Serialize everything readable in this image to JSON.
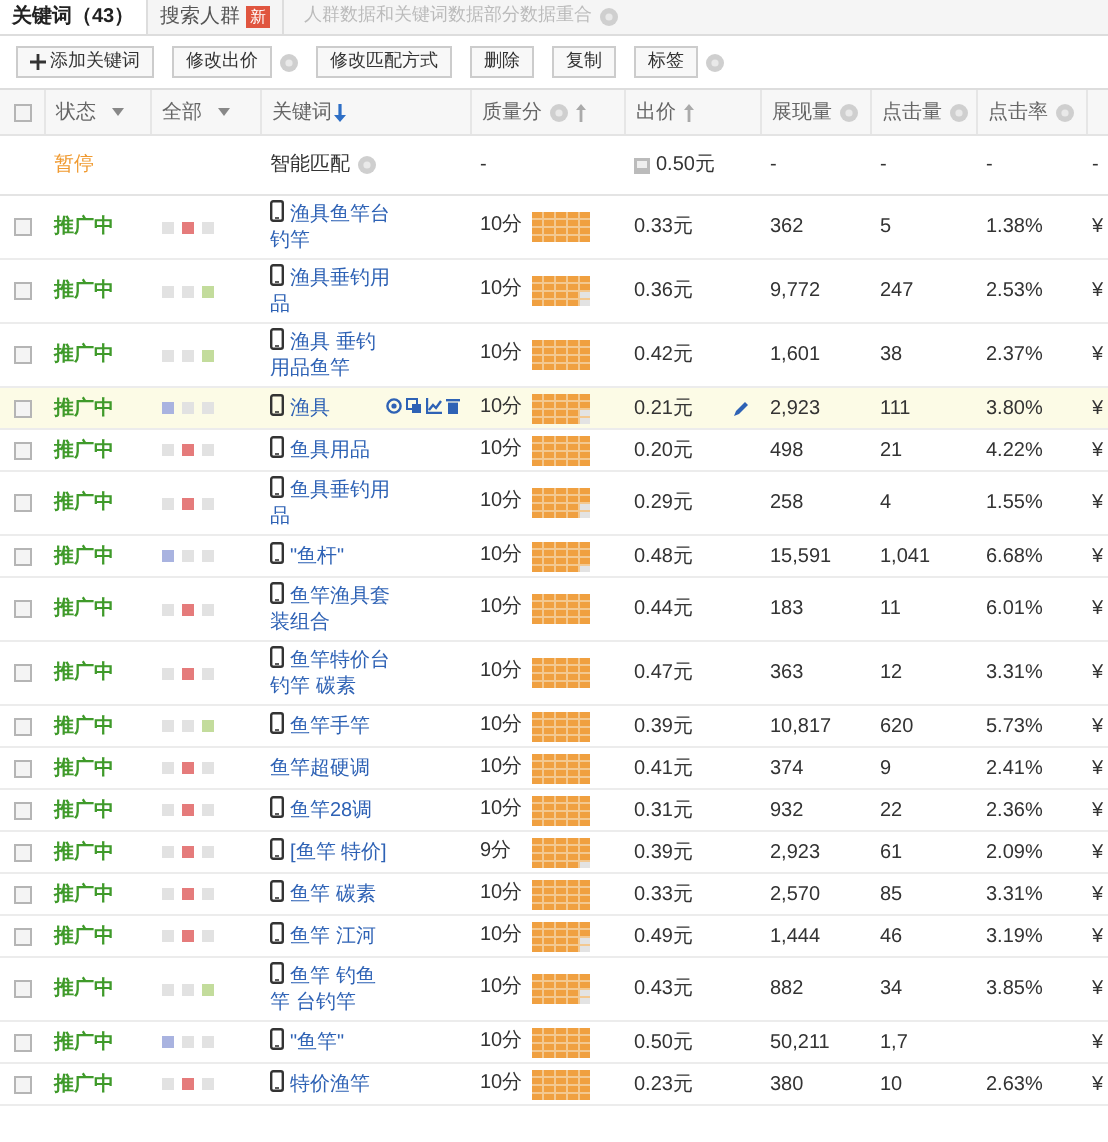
{
  "tabs": [
    {
      "label": "关键词（43）",
      "selected": true
    },
    {
      "label": "搜索人群",
      "badge": "新",
      "selected": false
    }
  ],
  "tab_note": "人群数据和关键词数据部分数据重合",
  "toolbar": [
    {
      "label": "添加关键词",
      "kind": "add",
      "help": false
    },
    {
      "label": "修改出价",
      "kind": "plain",
      "help": true
    },
    {
      "label": "修改匹配方式",
      "kind": "plain",
      "help": false
    },
    {
      "label": "删除",
      "kind": "plain",
      "help": false
    },
    {
      "label": "复制",
      "kind": "plain",
      "help": false
    },
    {
      "label": "标签",
      "kind": "plain",
      "help": true
    }
  ],
  "table": {
    "select_all": {
      "checked": false
    },
    "columns": [
      {
        "label": "状态",
        "kind": "dropdown"
      },
      {
        "label": "全部",
        "kind": "dropdown"
      },
      {
        "label": "关键词",
        "kind": "sorted"
      },
      {
        "label": "质量分",
        "kind": "help"
      },
      {
        "label": "出价",
        "kind": "sort"
      },
      {
        "label": "展现量",
        "kind": "help"
      },
      {
        "label": "点击量",
        "kind": "help"
      },
      {
        "label": "点击率",
        "kind": "help"
      }
    ],
    "smart_row": {
      "status": "暂停",
      "keyword": "智能匹配",
      "quality": "-",
      "bid": "0.50元",
      "impressions": "-",
      "clicks": "-",
      "ctr": "-",
      "column_9": "-"
    },
    "rows": [
      {
        "checked": false,
        "status": "推广中",
        "squares": [
          {
            "color": "#e2e2e2"
          },
          {
            "color": "#e57b7b"
          },
          {
            "color": "#e2e2e2"
          }
        ],
        "mobile": true,
        "keyword": "渔具鱼竿台钓竿",
        "quality": "10分",
        "level": 1,
        "bid": "0.33元",
        "impressions": "362",
        "clicks": "5",
        "ctr": "1.38%",
        "column_9": "¥",
        "highlighted": false
      },
      {
        "checked": false,
        "status": "推广中",
        "squares": [
          {
            "color": "#e2e2e2"
          },
          {
            "color": "#e2e2e2"
          },
          {
            "color": "#c3dc9c"
          }
        ],
        "mobile": true,
        "keyword": "渔具垂钓用品",
        "quality": "10分",
        "level": 0.9,
        "bid": "0.36元",
        "impressions": "9,772",
        "clicks": "247",
        "ctr": "2.53%",
        "column_9": "¥",
        "highlighted": false
      },
      {
        "checked": false,
        "status": "推广中",
        "squares": [
          {
            "color": "#e2e2e2"
          },
          {
            "color": "#e2e2e2"
          },
          {
            "color": "#c3dc9c"
          }
        ],
        "mobile": true,
        "keyword": "渔具 垂钓用品鱼竿",
        "quality": "10分",
        "level": 1,
        "bid": "0.42元",
        "impressions": "1,601",
        "clicks": "38",
        "ctr": "2.37%",
        "column_9": "¥",
        "highlighted": false
      },
      {
        "checked": false,
        "status": "推广中",
        "squares": [
          {
            "color": "#a9b3e0"
          },
          {
            "color": "#e2e2e2"
          },
          {
            "color": "#e2e2e2"
          }
        ],
        "mobile": true,
        "keyword": "渔具",
        "quality": "10分",
        "level": 0.9,
        "bid": "0.21元",
        "impressions": "2,923",
        "clicks": "111",
        "ctr": "3.80%",
        "column_9": "¥",
        "highlighted": true
      },
      {
        "checked": false,
        "status": "推广中",
        "squares": [
          {
            "color": "#e2e2e2"
          },
          {
            "color": "#e57b7b"
          },
          {
            "color": "#e2e2e2"
          }
        ],
        "mobile": true,
        "keyword": "鱼具用品",
        "quality": "10分",
        "level": 1,
        "bid": "0.20元",
        "impressions": "498",
        "clicks": "21",
        "ctr": "4.22%",
        "column_9": "¥",
        "highlighted": false
      },
      {
        "checked": false,
        "status": "推广中",
        "squares": [
          {
            "color": "#e2e2e2"
          },
          {
            "color": "#e57b7b"
          },
          {
            "color": "#e2e2e2"
          }
        ],
        "mobile": true,
        "keyword": "鱼具垂钓用品",
        "quality": "10分",
        "level": 0.9,
        "bid": "0.29元",
        "impressions": "258",
        "clicks": "4",
        "ctr": "1.55%",
        "column_9": "¥",
        "highlighted": false
      },
      {
        "checked": false,
        "status": "推广中",
        "squares": [
          {
            "color": "#a9b3e0"
          },
          {
            "color": "#e2e2e2"
          },
          {
            "color": "#e2e2e2"
          }
        ],
        "mobile": true,
        "keyword": "\"鱼杆\"",
        "quality": "10分",
        "level": 0.95,
        "bid": "0.48元",
        "impressions": "15,591",
        "clicks": "1,041",
        "ctr": "6.68%",
        "column_9": "¥",
        "highlighted": false
      },
      {
        "checked": false,
        "status": "推广中",
        "squares": [
          {
            "color": "#e2e2e2"
          },
          {
            "color": "#e57b7b"
          },
          {
            "color": "#e2e2e2"
          }
        ],
        "mobile": true,
        "keyword": "鱼竿渔具套装组合",
        "quality": "10分",
        "level": 1,
        "bid": "0.44元",
        "impressions": "183",
        "clicks": "11",
        "ctr": "6.01%",
        "column_9": "¥",
        "highlighted": false
      },
      {
        "checked": false,
        "status": "推广中",
        "squares": [
          {
            "color": "#e2e2e2"
          },
          {
            "color": "#e57b7b"
          },
          {
            "color": "#e2e2e2"
          }
        ],
        "mobile": true,
        "keyword": "鱼竿特价台钓竿 碳素",
        "quality": "10分",
        "level": 1,
        "bid": "0.47元",
        "impressions": "363",
        "clicks": "12",
        "ctr": "3.31%",
        "column_9": "¥",
        "highlighted": false
      },
      {
        "checked": false,
        "status": "推广中",
        "squares": [
          {
            "color": "#e2e2e2"
          },
          {
            "color": "#e2e2e2"
          },
          {
            "color": "#c3dc9c"
          }
        ],
        "mobile": true,
        "keyword": "鱼竿手竿",
        "quality": "10分",
        "level": 1,
        "bid": "0.39元",
        "impressions": "10,817",
        "clicks": "620",
        "ctr": "5.73%",
        "column_9": "¥",
        "highlighted": false
      },
      {
        "checked": false,
        "status": "推广中",
        "squares": [
          {
            "color": "#e2e2e2"
          },
          {
            "color": "#e57b7b"
          },
          {
            "color": "#e2e2e2"
          }
        ],
        "mobile": false,
        "keyword": "鱼竿超硬调",
        "quality": "10分",
        "level": 1,
        "bid": "0.41元",
        "impressions": "374",
        "clicks": "9",
        "ctr": "2.41%",
        "column_9": "¥",
        "highlighted": false
      },
      {
        "checked": false,
        "status": "推广中",
        "squares": [
          {
            "color": "#e2e2e2"
          },
          {
            "color": "#e57b7b"
          },
          {
            "color": "#e2e2e2"
          }
        ],
        "mobile": true,
        "keyword": "鱼竿28调",
        "quality": "10分",
        "level": 1,
        "bid": "0.31元",
        "impressions": "932",
        "clicks": "22",
        "ctr": "2.36%",
        "column_9": "¥",
        "highlighted": false
      },
      {
        "checked": false,
        "status": "推广中",
        "squares": [
          {
            "color": "#e2e2e2"
          },
          {
            "color": "#e57b7b"
          },
          {
            "color": "#e2e2e2"
          }
        ],
        "mobile": true,
        "keyword": "[鱼竿 特价]",
        "quality": "9分",
        "level": 0.95,
        "bid": "0.39元",
        "impressions": "2,923",
        "clicks": "61",
        "ctr": "2.09%",
        "column_9": "¥",
        "highlighted": false
      },
      {
        "checked": false,
        "status": "推广中",
        "squares": [
          {
            "color": "#e2e2e2"
          },
          {
            "color": "#e57b7b"
          },
          {
            "color": "#e2e2e2"
          }
        ],
        "mobile": true,
        "keyword": "鱼竿 碳素",
        "quality": "10分",
        "level": 1,
        "bid": "0.33元",
        "impressions": "2,570",
        "clicks": "85",
        "ctr": "3.31%",
        "column_9": "¥",
        "highlighted": false
      },
      {
        "checked": false,
        "status": "推广中",
        "squares": [
          {
            "color": "#e2e2e2"
          },
          {
            "color": "#e57b7b"
          },
          {
            "color": "#e2e2e2"
          }
        ],
        "mobile": true,
        "keyword": "鱼竿 江河",
        "quality": "10分",
        "level": 0.9,
        "bid": "0.49元",
        "impressions": "1,444",
        "clicks": "46",
        "ctr": "3.19%",
        "column_9": "¥",
        "highlighted": false
      },
      {
        "checked": false,
        "status": "推广中",
        "squares": [
          {
            "color": "#e2e2e2"
          },
          {
            "color": "#e2e2e2"
          },
          {
            "color": "#c3dc9c"
          }
        ],
        "mobile": true,
        "keyword": "鱼竿 钓鱼竿 台钓竿",
        "quality": "10分",
        "level": 0.9,
        "bid": "0.43元",
        "impressions": "882",
        "clicks": "34",
        "ctr": "3.85%",
        "column_9": "¥",
        "highlighted": false
      },
      {
        "checked": false,
        "status": "推广中",
        "squares": [
          {
            "color": "#a9b3e0"
          },
          {
            "color": "#e2e2e2"
          },
          {
            "color": "#e2e2e2"
          }
        ],
        "mobile": true,
        "keyword": "\"鱼竿\"",
        "quality": "10分",
        "level": 1,
        "bid": "0.50元",
        "impressions": "50,211",
        "clicks": "1,7",
        "column_9": "¥",
        "highlighted": false
      },
      {
        "checked": false,
        "status": "推广中",
        "squares": [
          {
            "color": "#e2e2e2"
          },
          {
            "color": "#e57b7b"
          },
          {
            "color": "#e2e2e2"
          }
        ],
        "mobile": true,
        "keyword": "特价渔竿",
        "quality": "10分",
        "level": 1,
        "bid": "0.23元",
        "impressions": "380",
        "clicks": "10",
        "ctr": "2.63%",
        "column_9": "¥",
        "highlighted": false
      }
    ]
  }
}
